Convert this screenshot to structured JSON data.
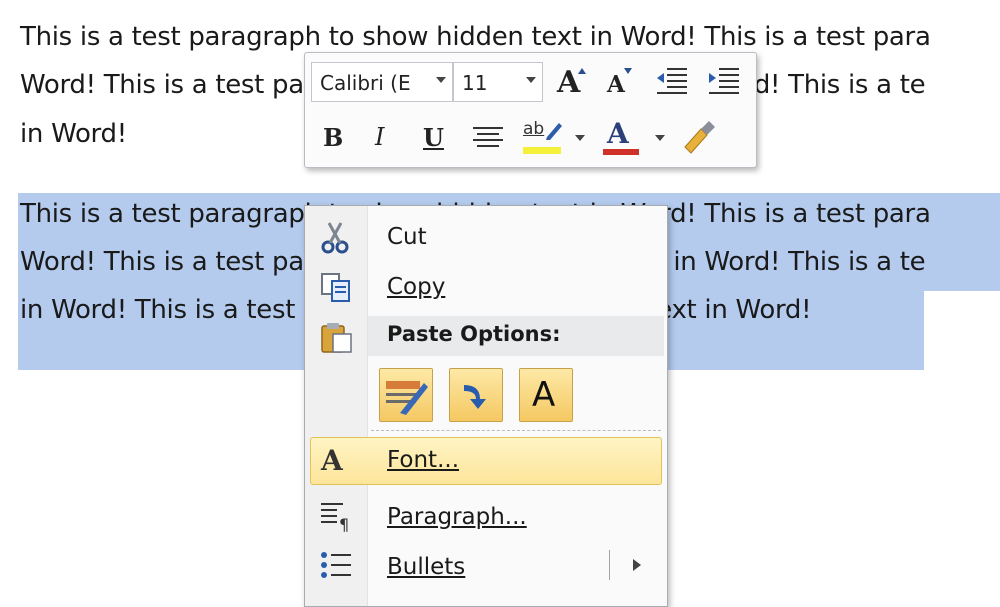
{
  "document": {
    "para1_lines": [
      "This is a test paragraph to show hidden text in Word! This is a test para",
      "Word! This is a test paragraph to show hidden text in Word! This is a te",
      "in Word!"
    ],
    "para2_lines": [
      "This is a test paragraph to show hidden text in Word! This is a test para",
      "Word! This is a test paragraph to show hidden text in Word! This is a te",
      "in Word! This is a test paragraph to show hidden text in Word!"
    ],
    "selection_color": "#b4cbee"
  },
  "mini_toolbar": {
    "font_name": "Calibri (E",
    "font_size": "11",
    "grow_font_label": "A",
    "shrink_font_label": "A",
    "bold_label": "B",
    "italic_label": "I",
    "underline_label": "U",
    "highlight_label": "ab",
    "font_color_label": "A",
    "highlight_color": "#f5f03a",
    "font_color": "#d0302a"
  },
  "context_menu": {
    "cut_label": "Cut",
    "copy_label": "Copy",
    "paste_options_label": "Paste Options:",
    "paste_keep_text_label": "A",
    "font_icon_label": "A",
    "font_label": "Font...",
    "paragraph_label": "Paragraph...",
    "bullets_label": "Bullets"
  }
}
